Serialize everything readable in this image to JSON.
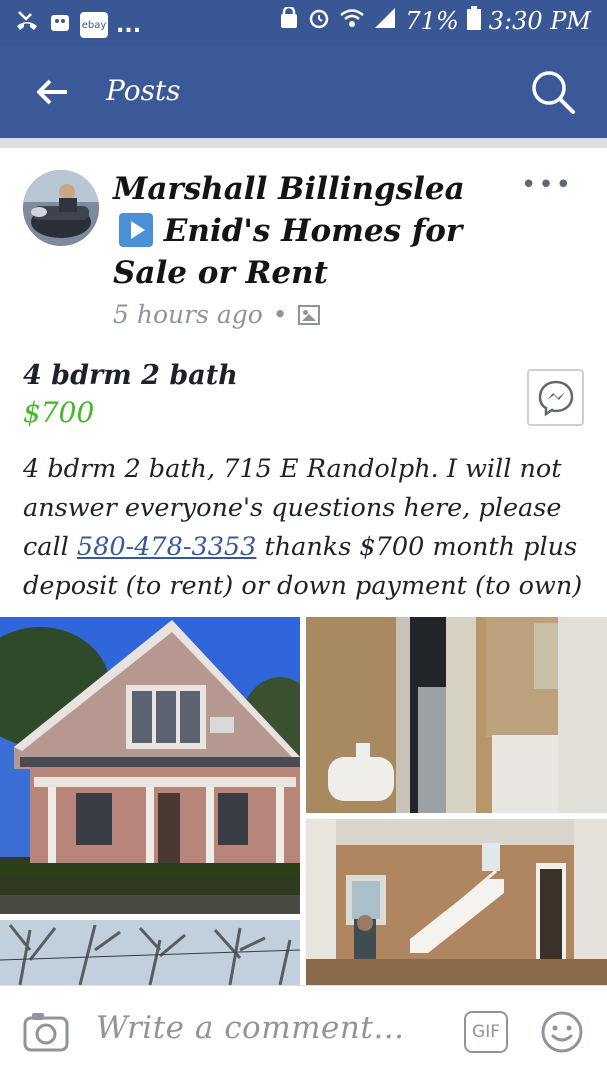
{
  "status_bar": {
    "ebay_label": "ebay",
    "overflow": "...",
    "battery_percent": "71%",
    "time": "3:30 PM",
    "icons": [
      "missed-call-icon",
      "ebay-app-icon",
      "android-icon",
      "alarm-icon",
      "wifi-icon",
      "signal-icon",
      "battery-icon"
    ]
  },
  "header": {
    "title": "Posts",
    "back_icon": "back-arrow-icon",
    "search_icon": "search-icon"
  },
  "post": {
    "author": "Marshall Billingslea",
    "group": "Enid's Homes for Sale or Rent",
    "timestamp": "5 hours ago",
    "separator": "•",
    "more_label": "•••",
    "listing": {
      "title": "4 bdrm 2 bath",
      "price": "$700"
    },
    "body": {
      "before_phone": "4 bdrm 2 bath, 715 E Randolph. I will not answer everyone's questions here, please call ",
      "phone": "580-478-3353",
      "after_phone": " thanks $700 month plus deposit (to rent) or down payment (to own)"
    }
  },
  "comment_bar": {
    "placeholder": "Write a comment…",
    "gif_label": "GIF"
  },
  "colors": {
    "brand_blue": "#3b5998",
    "price_green": "#42b72a",
    "link_blue": "#385898",
    "muted_grey": "#90949c"
  }
}
